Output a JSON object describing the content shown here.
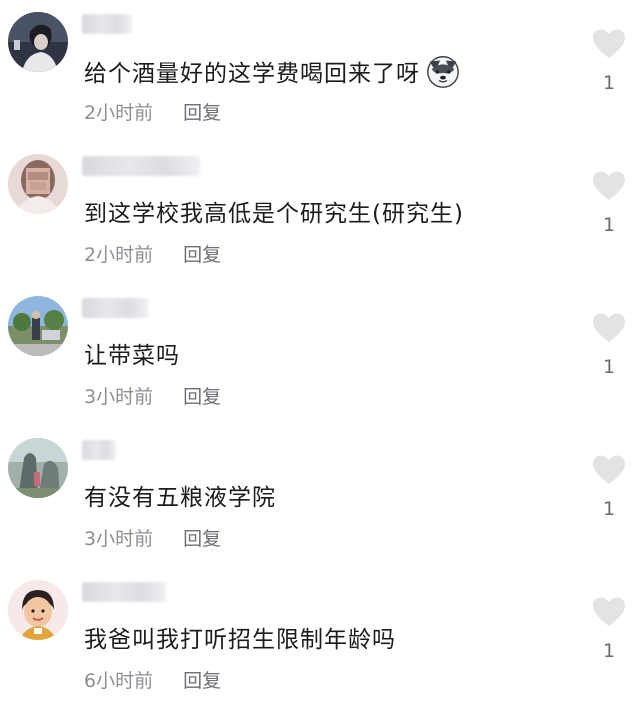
{
  "comments": [
    {
      "text": "给个酒量好的这学费喝回来了呀",
      "time": "2小时前",
      "reply_label": "回复",
      "likes": "1",
      "avatar": "anime-boy-avatar",
      "has_emoji": true,
      "emoji": "husky-dog-emoji"
    },
    {
      "text": "到这学校我高低是个研究生(研究生)",
      "time": "2小时前",
      "reply_label": "回复",
      "likes": "1",
      "avatar": "blurred-girl-avatar"
    },
    {
      "text": "让带菜吗",
      "time": "3小时前",
      "reply_label": "回复",
      "likes": "1",
      "avatar": "outdoor-photo-avatar"
    },
    {
      "text": "有没有五粮液学院",
      "time": "3小时前",
      "reply_label": "回复",
      "likes": "1",
      "avatar": "statue-photo-avatar"
    },
    {
      "text": "我爸叫我打听招生限制年龄吗",
      "time": "6小时前",
      "reply_label": "回复",
      "likes": "1",
      "avatar": "cartoon-man-avatar"
    }
  ],
  "colors": {
    "text": "#1c1c1e",
    "meta": "#8e8f94",
    "heart": "#e3e3e5"
  }
}
